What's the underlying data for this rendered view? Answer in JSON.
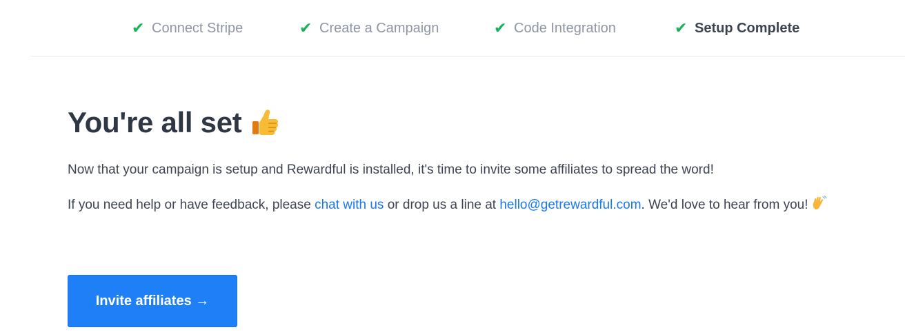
{
  "steps": [
    {
      "label": "Connect Stripe",
      "status": "complete",
      "icon": "check-icon"
    },
    {
      "label": "Create a Campaign",
      "status": "complete",
      "icon": "check-icon"
    },
    {
      "label": "Code Integration",
      "status": "complete",
      "icon": "check-icon"
    },
    {
      "label": "Setup Complete",
      "status": "current",
      "icon": "check-icon"
    }
  ],
  "check_glyph": "✔",
  "colors": {
    "check": "#19b15a",
    "link": "#1877f2",
    "button": "#1f7ff6",
    "heading": "#2f3744",
    "muted_step": "#8e96a3"
  },
  "main": {
    "title": "You're all set",
    "title_icon": "thumbs-up-emoji",
    "intro": "Now that your campaign is setup and Rewardful is installed, it's time to invite some affiliates to spread the word!",
    "help_before": "If you need help or have feedback, please ",
    "help_chat_link": "chat with us",
    "help_middle": " or drop us a line at ",
    "help_email_link": "hello@getrewardful.com",
    "help_after": ". We'd love to hear from you!",
    "help_icon": "waving-hand-emoji",
    "invite_button": "Invite affiliates →"
  }
}
